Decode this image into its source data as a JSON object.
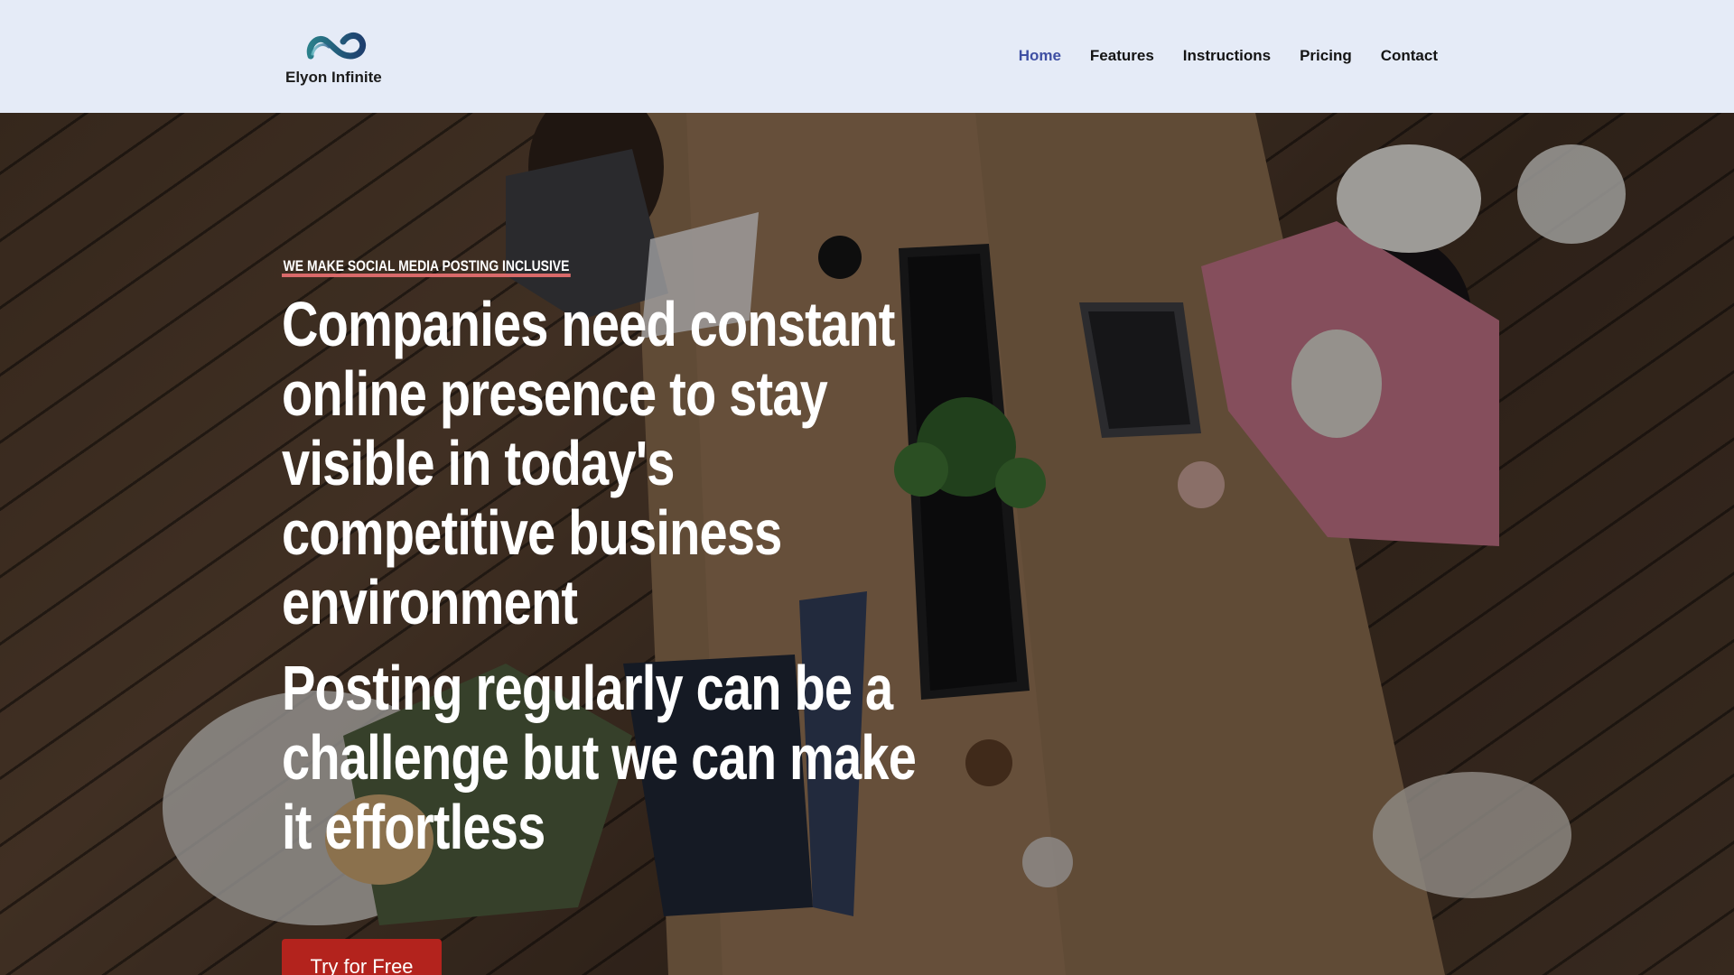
{
  "brand": {
    "name": "Elyon Infinite",
    "logo_icon": "infinity-logo-icon"
  },
  "nav": {
    "items": [
      {
        "label": "Home",
        "active": true
      },
      {
        "label": "Features",
        "active": false
      },
      {
        "label": "Instructions",
        "active": false
      },
      {
        "label": "Pricing",
        "active": false
      },
      {
        "label": "Contact",
        "active": false
      }
    ]
  },
  "hero": {
    "eyebrow": "WE MAKE SOCIAL MEDIA POSTING INCLUSIVE",
    "headline_1": "Companies need constant online presence to stay visible in today's competitive business environment",
    "headline_2": "Posting regularly can be a challenge but we can make it effortless",
    "cta_label": "Try for Free",
    "background_image": "office-team-working-at-wooden-table-photo"
  },
  "colors": {
    "header_bg": "#e5ebf7",
    "nav_active": "#3e4fa3",
    "cta_bg": "#b3231d",
    "eyebrow_underline": "#d96a6a"
  }
}
